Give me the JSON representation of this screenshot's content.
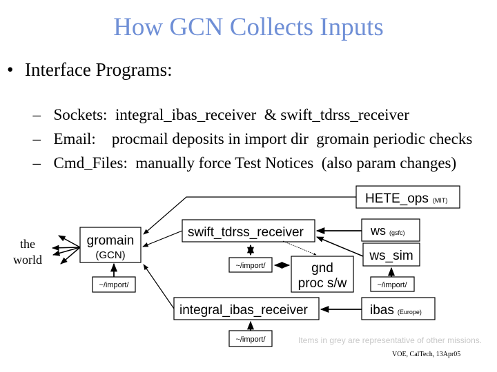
{
  "title": "How  GCN  Collects  Inputs",
  "bullet": {
    "marker": "•",
    "text": "Interface Programs:",
    "subitems": [
      {
        "marker": "–",
        "text": "Sockets:  integral_ibas_receiver  & swift_tdrss_receiver"
      },
      {
        "marker": "–",
        "text": "Email:    procmail deposits in import dir  gromain periodic checks"
      },
      {
        "marker": "–",
        "text": "Cmd_Files:  manually force Test Notices  (also param changes)"
      }
    ]
  },
  "diagram": {
    "world": {
      "line1": "the",
      "line2": "world"
    },
    "gromain": {
      "name": "gromain",
      "sub": "(GCN)",
      "import": "~/import/"
    },
    "swift_tdrss_receiver": {
      "name": "swift_tdrss_receiver",
      "import": "~/import/"
    },
    "gnd_proc": {
      "line1": "gnd",
      "line2": "proc s/w"
    },
    "integral_ibas_receiver": {
      "name": "integral_ibas_receiver",
      "import": "~/import/"
    },
    "hete_ops": {
      "name": "HETE_ops",
      "org": "(MIT)"
    },
    "ws": {
      "name": "ws",
      "org": "(gsfc)"
    },
    "ws_sim": {
      "name": "ws_sim",
      "import": "~/import/"
    },
    "ibas": {
      "name": "ibas",
      "org": "(Europe)"
    }
  },
  "note": "Items in grey are representative of other missions.",
  "credit": "VOE, CalTech, 13Apr05"
}
